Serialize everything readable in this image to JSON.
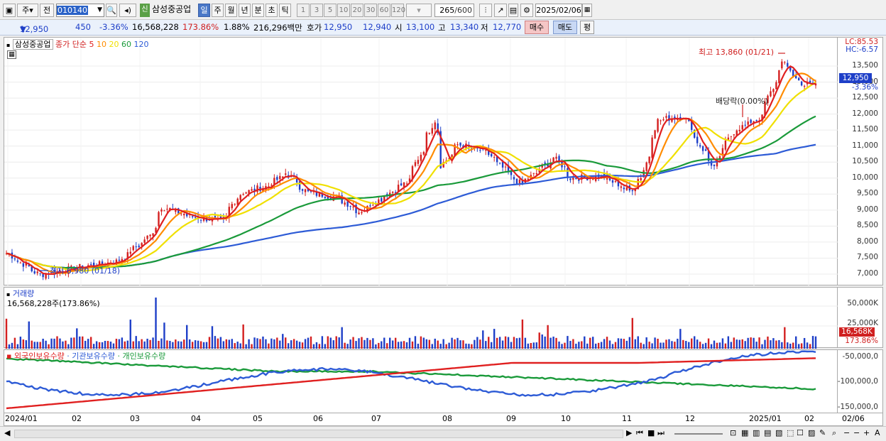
{
  "toolbar": {
    "type_label": "주",
    "prev_label": "전",
    "code_value": "010140",
    "company": "삼성중공업",
    "credit_tag": "신",
    "periods": [
      "일",
      "주",
      "월",
      "년",
      "분",
      "초",
      "틱"
    ],
    "active_period": "일",
    "intervals": [
      "1",
      "3",
      "5",
      "10",
      "20",
      "30",
      "60",
      "120"
    ],
    "count_value": "265",
    "count_total": "/600",
    "date_value": "2025/02/06"
  },
  "info": {
    "price": "12,950",
    "change": "450",
    "change_pct": "-3.36%",
    "volume": "16,568,228",
    "volume_ratio": "173.86%",
    "turnover": "1.88%",
    "amount": "216,296백만",
    "quote_label": "호가",
    "ask": "12,950",
    "bid": "12,940",
    "open_label": "시",
    "open": "13,100",
    "high_label": "고",
    "high": "13,340",
    "low_label": "저",
    "low": "12,770",
    "buy_label": "매수",
    "sell_label": "매도",
    "eval_label": "평"
  },
  "price_panel": {
    "stock_name": "삼성중공업",
    "legend_prefix": "종가 단순",
    "ma": [
      {
        "period": "5",
        "color": "#e02020"
      },
      {
        "period": "10",
        "color": "#ff8c00"
      },
      {
        "period": "20",
        "color": "#f0e000"
      },
      {
        "period": "60",
        "color": "#1a9a3a"
      },
      {
        "period": "120",
        "color": "#2d5bd6"
      }
    ],
    "lc": "LC:85.53",
    "hc": "HC:-6.57",
    "high_note": "최고 13,860 (01/21)",
    "low_note": "최저 6,980 (01/18)",
    "dividend_note": "배당락(0.00%)",
    "last_price": "12,950",
    "last_pct": "-3.36%",
    "y_ticks": [
      "13,500",
      "13,000",
      "12,500",
      "12,000",
      "11,500",
      "11,000",
      "10,500",
      "10,000",
      "9,500",
      "9,000",
      "8,500",
      "8,000",
      "7,500",
      "7,000"
    ]
  },
  "volume_panel": {
    "title": "거래량",
    "value": "16,568,228주(173.86%)",
    "y_ticks": [
      "50,000K",
      "25,000K"
    ],
    "last_value": "16,568K",
    "last_pct": "173.86%"
  },
  "holding_panel": {
    "legend": [
      {
        "name": "외국인보유수량",
        "color": "#e02020"
      },
      {
        "name": "기관보유수량",
        "color": "#2d5bd6"
      },
      {
        "name": "개인보유수량",
        "color": "#1a9a3a"
      }
    ],
    "y_ticks": [
      "-50,000,0",
      "-100,000,0",
      "-150,000,0"
    ]
  },
  "x_axis": {
    "labels": [
      "2024/01",
      "02",
      "03",
      "04",
      "05",
      "06",
      "07",
      "08",
      "09",
      "10",
      "11",
      "12",
      "2025/01",
      "02",
      "02/06"
    ]
  },
  "chart_data": {
    "type": "candlestick",
    "period": "daily",
    "x_range": [
      "2024/01",
      "2025/02/06"
    ],
    "ylim": [
      6800,
      13900
    ],
    "moving_averages": [
      "5",
      "10",
      "20",
      "60",
      "120"
    ],
    "close_series_approx": [
      {
        "date": "2024/01/02",
        "close": 7650
      },
      {
        "date": "2024/01/18",
        "close": 6980
      },
      {
        "date": "2024/02/05",
        "close": 7200
      },
      {
        "date": "2024/02/26",
        "close": 7400
      },
      {
        "date": "2024/03/05",
        "close": 7800
      },
      {
        "date": "2024/03/13",
        "close": 8200
      },
      {
        "date": "2024/03/19",
        "close": 9100
      },
      {
        "date": "2024/04/02",
        "close": 8800
      },
      {
        "date": "2024/04/18",
        "close": 8650
      },
      {
        "date": "2024/04/26",
        "close": 9500
      },
      {
        "date": "2024/05/10",
        "close": 9750
      },
      {
        "date": "2024/05/20",
        "close": 10150
      },
      {
        "date": "2024/05/30",
        "close": 9550
      },
      {
        "date": "2024/06/14",
        "close": 9400
      },
      {
        "date": "2024/06/25",
        "close": 8950
      },
      {
        "date": "2024/07/05",
        "close": 9350
      },
      {
        "date": "2024/07/19",
        "close": 9900
      },
      {
        "date": "2024/07/26",
        "close": 10900
      },
      {
        "date": "2024/08/01",
        "close": 11800
      },
      {
        "date": "2024/08/05",
        "close": 10400
      },
      {
        "date": "2024/08/13",
        "close": 11050
      },
      {
        "date": "2024/08/27",
        "close": 10800
      },
      {
        "date": "2024/09/06",
        "close": 10200
      },
      {
        "date": "2024/09/13",
        "close": 9800
      },
      {
        "date": "2024/09/30",
        "close": 10650
      },
      {
        "date": "2024/10/08",
        "close": 10000
      },
      {
        "date": "2024/10/24",
        "close": 10050
      },
      {
        "date": "2024/11/06",
        "close": 9600
      },
      {
        "date": "2024/11/12",
        "close": 10050
      },
      {
        "date": "2024/11/20",
        "close": 11800
      },
      {
        "date": "2024/12/03",
        "close": 11950
      },
      {
        "date": "2024/12/12",
        "close": 10900
      },
      {
        "date": "2024/12/18",
        "close": 10350
      },
      {
        "date": "2024/12/27",
        "close": 11450
      },
      {
        "date": "2025/01/10",
        "close": 11900
      },
      {
        "date": "2025/01/21",
        "close": 13600
      },
      {
        "date": "2025/01/31",
        "close": 12900
      },
      {
        "date": "2025/02/06",
        "close": 12950
      }
    ],
    "annotations": {
      "high": "최고 13,860 (01/21)",
      "low": "최저 6,980 (01/18)",
      "dividend": "배당락(0.00%)"
    }
  }
}
